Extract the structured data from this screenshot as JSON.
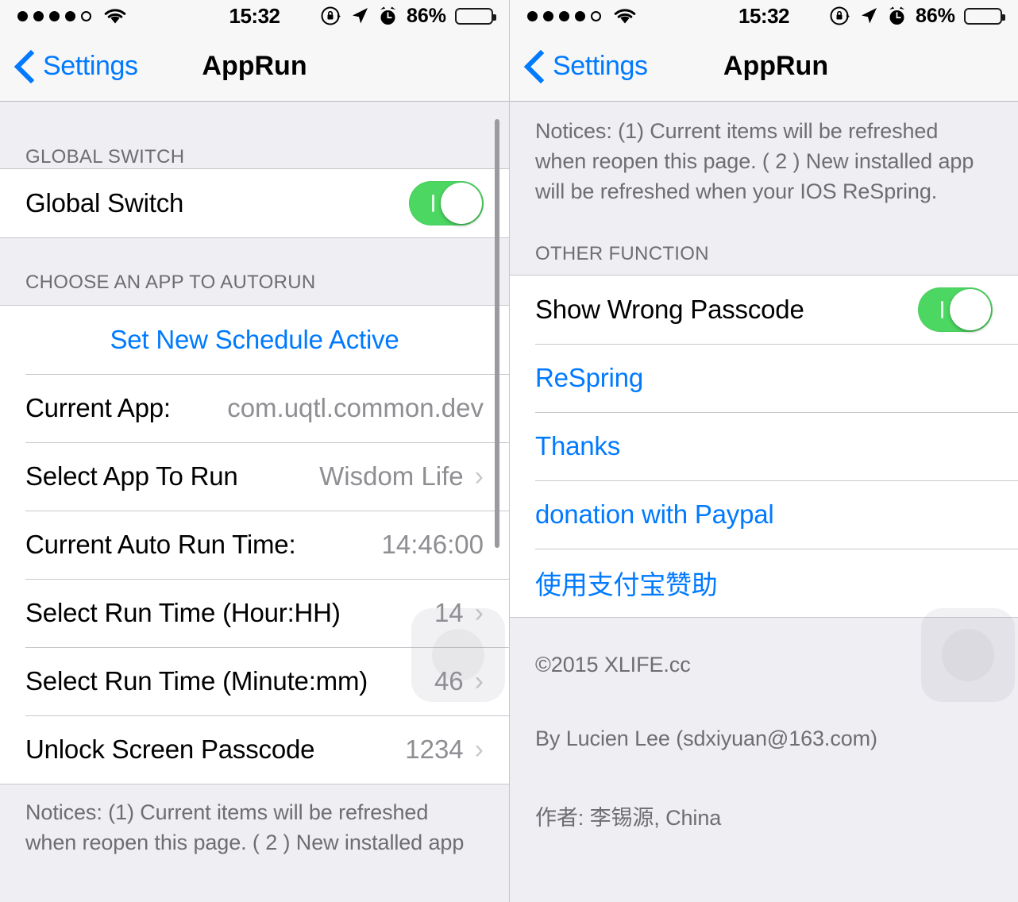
{
  "status_bar": {
    "signal_dots_filled": 4,
    "signal_dots_total": 5,
    "wifi_icon": "wifi-icon",
    "time": "15:32",
    "rotation_lock_icon": "rotation-lock-icon",
    "location_icon": "location-arrow-icon",
    "alarm_icon": "alarm-clock-icon",
    "battery_percent": "86%",
    "battery_level": 86,
    "battery_color": "#00e23d"
  },
  "nav": {
    "back_label": "Settings",
    "back_icon": "chevron-left-icon",
    "title": "AppRun"
  },
  "colors": {
    "tint": "#007aff",
    "toggle_on": "#4cd662",
    "secondary_text": "#8e8e93",
    "header_text": "#6d6d72",
    "group_bg": "#ffffff",
    "page_bg": "#eeeef3"
  },
  "left_screen": {
    "sections": [
      {
        "header": "GLOBAL SWITCH",
        "rows": [
          {
            "label": "Global Switch",
            "type": "toggle",
            "value": "on"
          }
        ]
      },
      {
        "header": "CHOOSE AN APP TO AUTORUN",
        "rows": [
          {
            "label": "Set New Schedule Active",
            "type": "action"
          },
          {
            "label": "Current App:",
            "type": "value",
            "value": "com.uqtl.common.dev"
          },
          {
            "label": "Select App To Run",
            "type": "disclosure",
            "value": "Wisdom Life"
          },
          {
            "label": "Current Auto Run Time:",
            "type": "value",
            "value": "14:46:00"
          },
          {
            "label": "Select Run Time (Hour:HH)",
            "type": "disclosure",
            "value": "14"
          },
          {
            "label": "Select Run Time (Minute:mm)",
            "type": "disclosure",
            "value": "46"
          },
          {
            "label": "Unlock Screen Passcode",
            "type": "disclosure",
            "value": "1234"
          }
        ]
      }
    ],
    "footer_note": "Notices: (1) Current items will be refreshed when reopen this page. ( 2 ) New installed app"
  },
  "right_screen": {
    "top_note": "Notices: (1) Current items will be refreshed when reopen this page. ( 2 ) New installed app will be refreshed when your IOS ReSpring.",
    "section_header": "OTHER FUNCTION",
    "rows": [
      {
        "label": "Show Wrong Passcode",
        "type": "toggle",
        "value": "on"
      },
      {
        "label": "ReSpring",
        "type": "link"
      },
      {
        "label": "Thanks",
        "type": "link"
      },
      {
        "label": "donation with Paypal",
        "type": "link"
      },
      {
        "label": "使用支付宝赞助",
        "type": "link"
      }
    ],
    "footer": [
      "©2015 XLIFE.cc",
      "By Lucien Lee (sdxiyuan@163.com)",
      "作者: 李锡源, China"
    ]
  }
}
